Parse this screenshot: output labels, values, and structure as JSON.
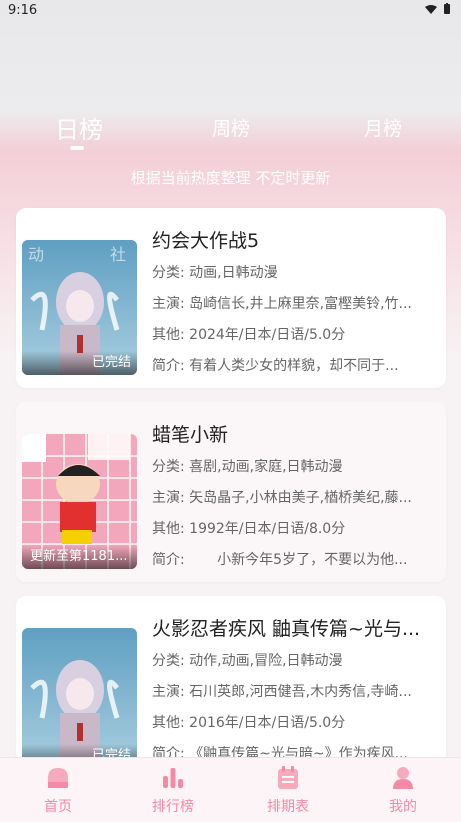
{
  "status_bar": {
    "time": "9:16"
  },
  "tabs": [
    "日榜",
    "周榜",
    "月榜"
  ],
  "subtitle": "根据当前热度整理 不定时更新",
  "items": [
    {
      "title": "约会大作战5",
      "category_label": "分类:",
      "category": "动画,日韩动漫",
      "cast_label": "主演:",
      "cast": "岛崎信长,井上麻里奈,富樫美铃,竹...",
      "other_label": "其他:",
      "other": "2024年/日本/日语/5.0分",
      "intro_label": "简介:",
      "intro": "有着人类少女的样貌，却不同于...",
      "badge": "已完结"
    },
    {
      "title": "蜡笔小新",
      "category_label": "分类:",
      "category": "喜剧,动画,家庭,日韩动漫",
      "cast_label": "主演:",
      "cast": "矢岛晶子,小林由美子,楢桥美纪,藤...",
      "other_label": "其他:",
      "other": "1992年/日本/日语/8.0分",
      "intro_label": "简介:",
      "intro": "　　小新今年5岁了，不要以为他...",
      "badge": "更新至第1181..."
    },
    {
      "title": "火影忍者疾风 鼬真传篇~光与...",
      "category_label": "分类:",
      "category": "动作,动画,冒险,日韩动漫",
      "cast_label": "主演:",
      "cast": "石川英郎,河西健吾,木内秀信,寺崎...",
      "other_label": "其他:",
      "other": "2016年/日本/日语/5.0分",
      "intro_label": "简介:",
      "intro": "《鼬真传篇~光与暗~》作为疾风...",
      "badge": "已完结"
    }
  ],
  "nav": [
    {
      "label": "首页",
      "icon": "home-icon"
    },
    {
      "label": "排行榜",
      "icon": "ranking-icon"
    },
    {
      "label": "排期表",
      "icon": "schedule-icon"
    },
    {
      "label": "我的",
      "icon": "profile-icon"
    }
  ],
  "colors": {
    "accent": "#f48aa6"
  }
}
